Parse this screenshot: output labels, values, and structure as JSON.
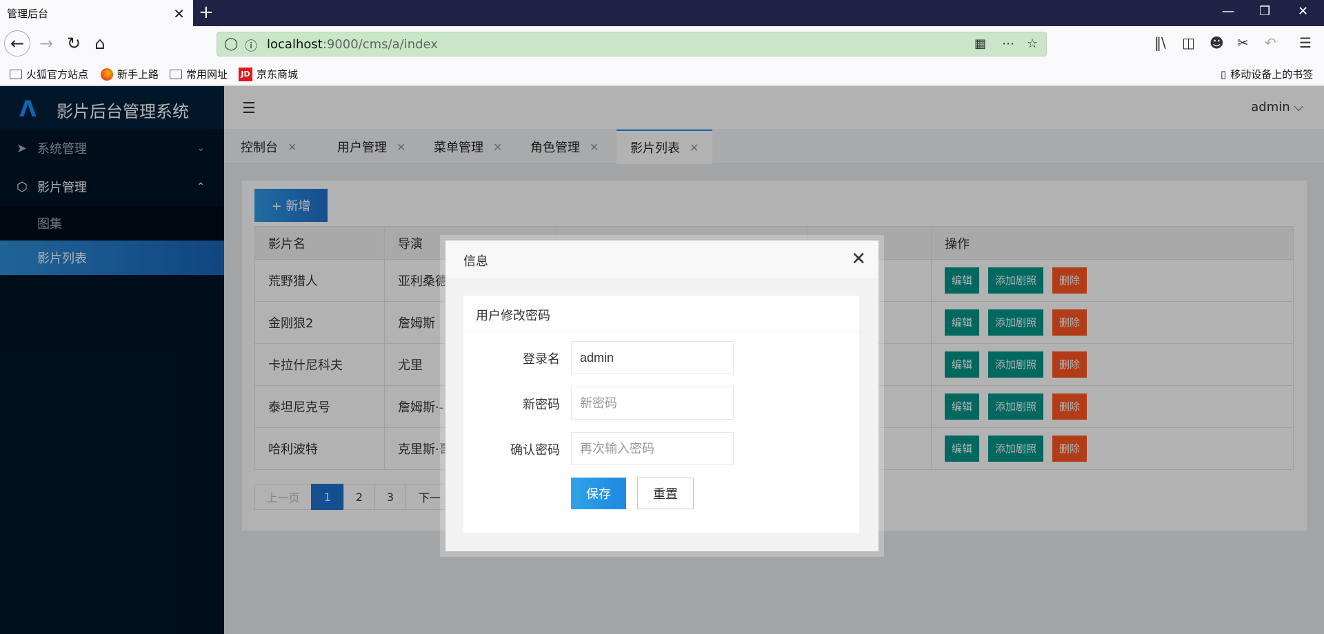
{
  "browser": {
    "tab_title": "管理后台",
    "tab_close": "✕",
    "new_tab": "+",
    "url_host": "localhost",
    "url_rest": ":9000/cms/a/index",
    "bookmarks": [
      "火狐官方站点",
      "新手上路",
      "常用网址",
      "京东商城"
    ],
    "jd_logo_text": "JD",
    "mobile_bookmarks": "移动设备上的书签"
  },
  "app": {
    "title": "影片后台管理系统",
    "user": "admin ⌵",
    "sidebar": {
      "items": [
        {
          "label": "系统管理",
          "chevron": "⌄",
          "icon": "paper-plane-icon"
        },
        {
          "label": "影片管理",
          "chevron": "⌃",
          "icon": "cube-icon"
        }
      ],
      "subitems": [
        "图集",
        "影片列表"
      ]
    },
    "tabs": [
      {
        "label": "控制台",
        "close": "✕"
      },
      {
        "label": "用户管理",
        "close": "✕"
      },
      {
        "label": "菜单管理",
        "close": "✕"
      },
      {
        "label": "角色管理",
        "close": "✕"
      },
      {
        "label": "影片列表",
        "close": "✕"
      }
    ],
    "add_button": "+ 新增",
    "table": {
      "headers": [
        "影片名",
        "导演",
        "",
        "",
        "操作"
      ],
      "rows": [
        {
          "name": "荒野猎人",
          "director": "亚利桑德"
        },
        {
          "name": "金刚狼2",
          "director": "詹姆斯"
        },
        {
          "name": "卡拉什尼科夫",
          "director": "尤里"
        },
        {
          "name": "泰坦尼克号",
          "director": "詹姆斯·-"
        },
        {
          "name": "哈利波特",
          "director": "克里斯·哥"
        }
      ],
      "actions": {
        "edit": "编辑",
        "add_photo": "添加剧照",
        "delete": "删除"
      }
    },
    "pager": {
      "prev": "上一页",
      "pages": [
        "1",
        "2",
        "3"
      ],
      "next": "下一"
    }
  },
  "dialog": {
    "title": "信息",
    "close": "✕",
    "card_title": "用户修改密码",
    "login_label": "登录名",
    "login_value": "admin",
    "new_pwd_label": "新密码",
    "new_pwd_placeholder": "新密码",
    "confirm_label": "确认密码",
    "confirm_placeholder": "再次输入密码",
    "save": "保存",
    "reset": "重置"
  },
  "colors": {
    "accent": "#1890ff",
    "sidebar_bg": "#001529",
    "teal": "#009688",
    "danger": "#ff5722"
  }
}
